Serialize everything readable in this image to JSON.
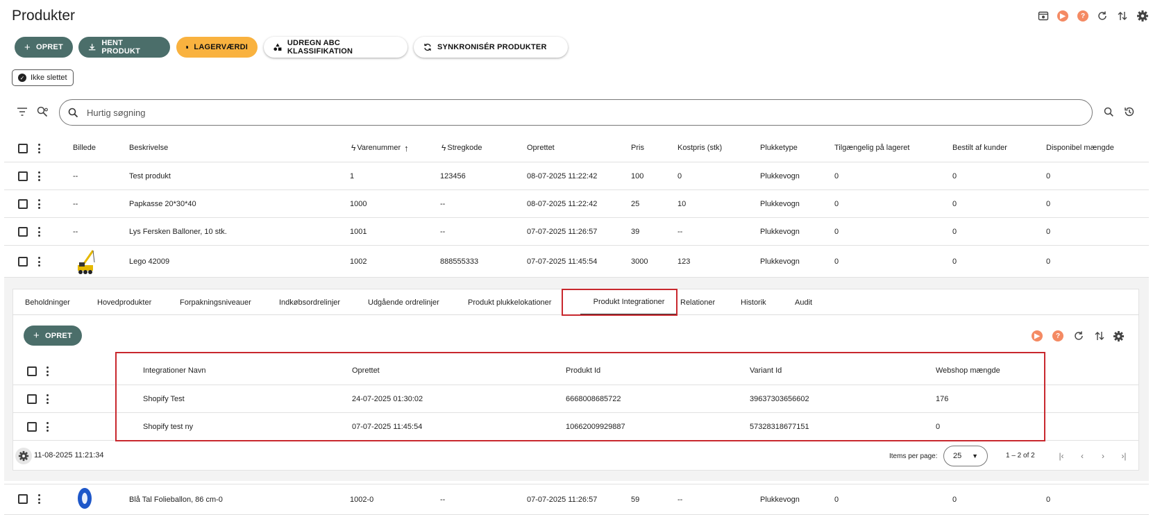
{
  "page": {
    "title": "Produkter"
  },
  "toolbar": {
    "create": "OPRET",
    "fetch": "HENT PRODUKT",
    "stock_value": "LAGERVÆRDI",
    "abc": "UDREGN ABC KLASSIFIKATION",
    "sync": "SYNKRONISÉR PRODUKTER"
  },
  "filter_chip": "Ikke slettet",
  "search": {
    "placeholder": "Hurtig søgning"
  },
  "table": {
    "headers": {
      "image": "Billede",
      "description": "Beskrivelse",
      "item_number": "Varenummer",
      "barcode": "Stregkode",
      "created": "Oprettet",
      "price": "Pris",
      "cost": "Kostpris (stk)",
      "pick_type": "Plukketype",
      "available": "Tilgængelig på lageret",
      "ordered": "Bestilt af kunder",
      "disposable": "Disponibel mængde"
    },
    "rows": [
      {
        "image": "--",
        "description": "Test produkt",
        "item_number": "1",
        "barcode": "123456",
        "created": "08-07-2025 11:22:42",
        "price": "100",
        "cost": "0",
        "pick_type": "Plukkevogn",
        "available": "0",
        "ordered": "0",
        "disposable": "0"
      },
      {
        "image": "--",
        "description": "Papkasse 20*30*40",
        "item_number": "1000",
        "barcode": "--",
        "created": "08-07-2025 11:22:42",
        "price": "25",
        "cost": "10",
        "pick_type": "Plukkevogn",
        "available": "0",
        "ordered": "0",
        "disposable": "0"
      },
      {
        "image": "--",
        "description": "Lys Fersken Balloner, 10 stk.",
        "item_number": "1001",
        "barcode": "--",
        "created": "07-07-2025 11:26:57",
        "price": "39",
        "cost": "--",
        "pick_type": "Plukkevogn",
        "available": "0",
        "ordered": "0",
        "disposable": "0"
      },
      {
        "image": "",
        "description": "Lego 42009",
        "item_number": "1002",
        "barcode": "888555333",
        "created": "07-07-2025 11:45:54",
        "price": "3000",
        "cost": "123",
        "pick_type": "Plukkevogn",
        "available": "0",
        "ordered": "0",
        "disposable": "0"
      },
      {
        "image": "",
        "description": "Blå Tal Folieballon, 86 cm-0",
        "item_number": "1002-0",
        "barcode": "--",
        "created": "07-07-2025 11:26:57",
        "price": "59",
        "cost": "--",
        "pick_type": "Plukkevogn",
        "available": "0",
        "ordered": "0",
        "disposable": "0"
      }
    ]
  },
  "detail": {
    "tabs": [
      "Beholdninger",
      "Hovedprodukter",
      "Forpakningsniveauer",
      "Indkøbsordrelinjer",
      "Udgående ordrelinjer",
      "Produkt plukkelokationer",
      "Produkt Integrationer",
      "Relationer",
      "Historik",
      "Audit"
    ],
    "active_tab": "Produkt Integrationer",
    "create": "OPRET",
    "headers": {
      "name": "Integrationer Navn",
      "created": "Oprettet",
      "product_id": "Produkt Id",
      "variant_id": "Variant Id",
      "webshop_qty": "Webshop mængde"
    },
    "rows": [
      {
        "name": "Shopify Test",
        "created": "24-07-2025 01:30:02",
        "product_id": "6668008685722",
        "variant_id": "39637303656602",
        "webshop_qty": "176"
      },
      {
        "name": "Shopify test ny",
        "created": "07-07-2025 11:45:54",
        "product_id": "10662009929887",
        "variant_id": "57328318677151",
        "webshop_qty": "0"
      }
    ],
    "timestamp": "11-08-2025 11:21:34",
    "items_per_page_label": "Items per page:",
    "items_per_page": "25",
    "range": "1 – 2 of 2"
  },
  "colors": {
    "accent": "#4b6e6a",
    "orange": "#f9b23f",
    "highlight": "#c8272d",
    "icon_orange": "#f48a63"
  }
}
